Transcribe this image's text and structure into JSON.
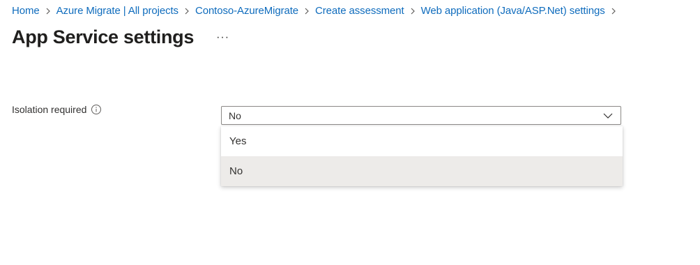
{
  "breadcrumb": {
    "items": [
      "Home",
      "Azure Migrate | All projects",
      "Contoso-AzureMigrate",
      "Create assessment",
      "Web application (Java/ASP.Net) settings"
    ],
    "separator_icon": "chevron-right-icon"
  },
  "page": {
    "title": "App Service settings",
    "more_label": "···"
  },
  "form": {
    "isolation": {
      "label": "Isolation required",
      "info_icon": "info-icon",
      "selected": "No",
      "options": [
        "Yes",
        "No"
      ]
    }
  },
  "colors": {
    "link": "#0f6cbd",
    "text": "#323130",
    "selected_option_bg": "#edebe9",
    "border": "#8a8886"
  }
}
